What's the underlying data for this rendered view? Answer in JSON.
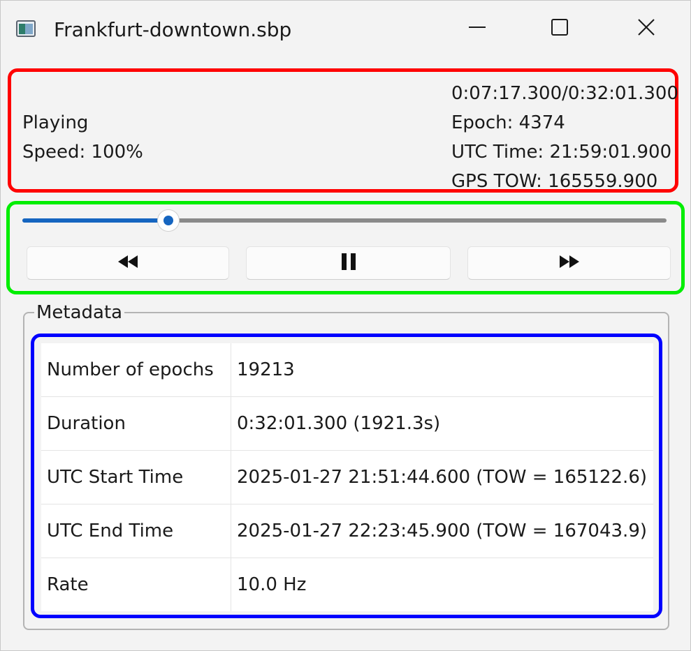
{
  "window": {
    "title": "Frankfurt-downtown.sbp",
    "icon": "app-window-icon",
    "controls": [
      "minimize-icon",
      "maximize-icon",
      "close-icon"
    ]
  },
  "status": {
    "state": "Playing",
    "speed": "Speed: 100%",
    "time": "0:07:17.300/0:32:01.300",
    "epoch": "Epoch: 4374",
    "utc_time": "UTC Time: 21:59:01.900",
    "gps_tow": "GPS TOW: 165559.900"
  },
  "playback": {
    "progress_fraction": 0.227,
    "buttons": [
      {
        "name": "rewind",
        "icon": "rewind-icon"
      },
      {
        "name": "pause",
        "icon": "pause-icon"
      },
      {
        "name": "fast-forward",
        "icon": "fast-forward-icon"
      }
    ],
    "accent_color": "#1565c0"
  },
  "metadata": {
    "legend": "Metadata",
    "rows": [
      {
        "key": "Number of epochs",
        "value": "19213"
      },
      {
        "key": "Duration",
        "value": "0:32:01.300 (1921.3s)"
      },
      {
        "key": "UTC Start Time",
        "value": "2025-01-27 21:51:44.600 (TOW = 165122.6)"
      },
      {
        "key": "UTC End Time",
        "value": "2025-01-27 22:23:45.900 (TOW = 167043.9)"
      },
      {
        "key": "Rate",
        "value": "10.0 Hz"
      }
    ]
  },
  "highlight_colors": {
    "status": "#ff0000",
    "controls": "#00ee00",
    "metadata": "#0000ff"
  }
}
